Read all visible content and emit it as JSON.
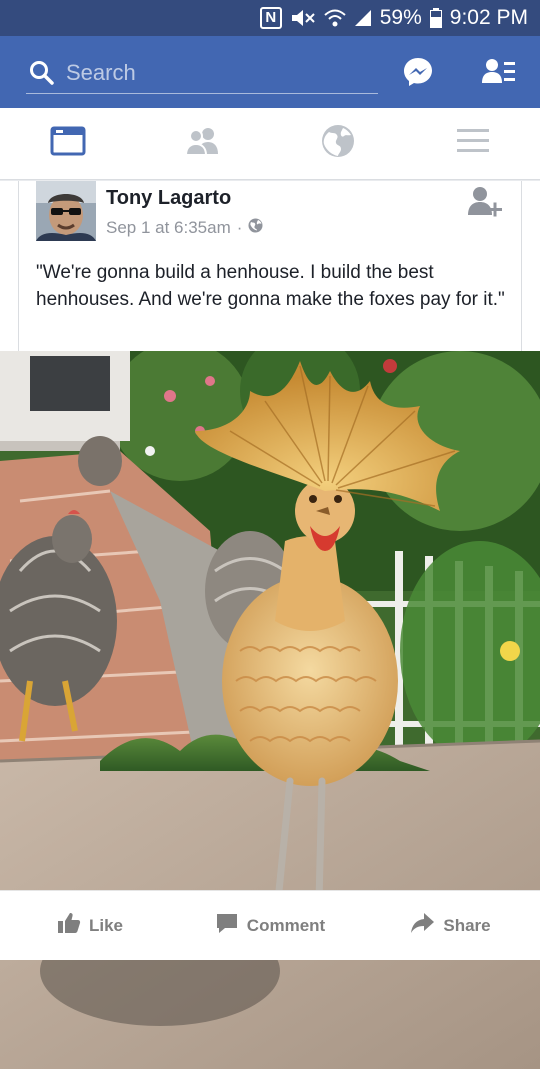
{
  "status_bar": {
    "battery": "59%",
    "time": "9:02 PM",
    "icons": [
      "nfc-icon",
      "mute-icon",
      "wifi-icon",
      "signal-icon",
      "battery-icon"
    ]
  },
  "header": {
    "search_placeholder": "Search",
    "icons": [
      "search-icon",
      "messenger-icon",
      "friend-requests-icon"
    ]
  },
  "tabs": [
    {
      "name": "news-feed",
      "icon": "news-feed-icon",
      "active": true
    },
    {
      "name": "friends",
      "icon": "friends-icon",
      "active": false
    },
    {
      "name": "notifications",
      "icon": "globe-icon",
      "active": false
    },
    {
      "name": "menu",
      "icon": "menu-icon",
      "active": false
    }
  ],
  "post": {
    "author": "Tony Lagarto",
    "timestamp": "Sep 1 at 6:35am",
    "separator": "·",
    "privacy_icon": "public-globe-icon",
    "text": "\"We're gonna build a henhouse. I build the best henhouses. And we're gonna make the foxes pay for it.\""
  },
  "actions": {
    "like": "Like",
    "comment": "Comment",
    "share": "Share"
  },
  "colors": {
    "header_blue": "#4267b2",
    "status_blue": "#344b7e",
    "active_tab": "#4267b2",
    "inactive_tab": "#bec3c9",
    "text_dark": "#1d2129",
    "text_gray": "#90949c"
  }
}
